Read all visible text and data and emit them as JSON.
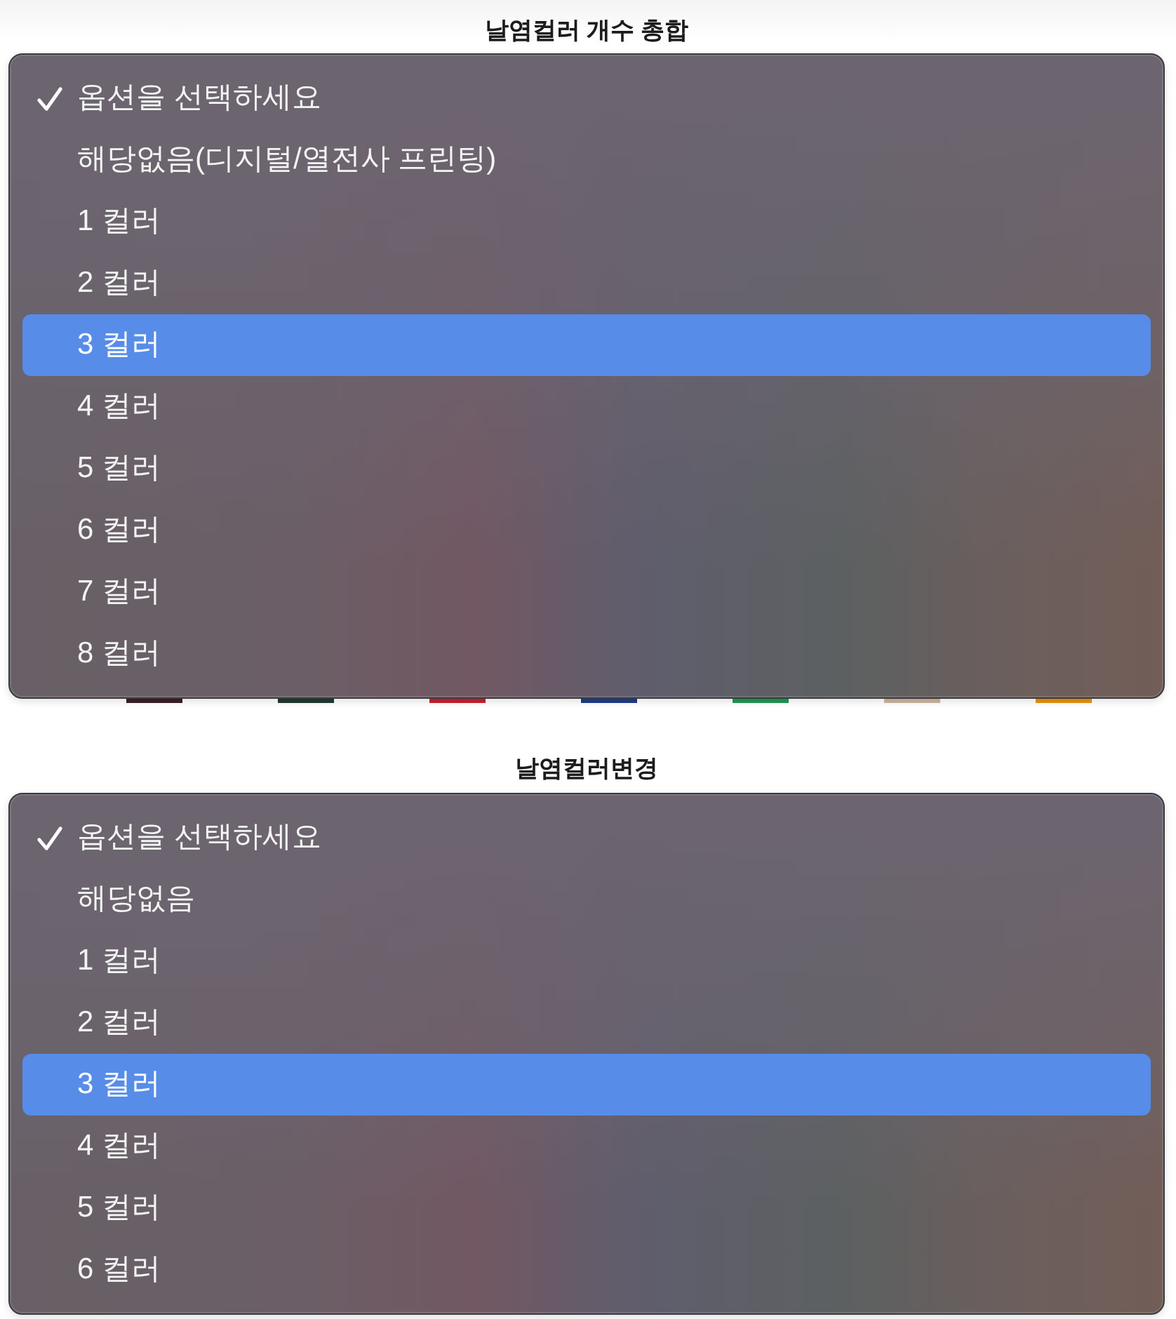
{
  "dropdowns": [
    {
      "label": "날염컬러 개수 총합",
      "options": [
        {
          "text": "옵션을 선택하세요",
          "checked": true,
          "selected": false
        },
        {
          "text": "해당없음(디지털/열전사 프린팅)",
          "checked": false,
          "selected": false
        },
        {
          "text": "1 컬러",
          "checked": false,
          "selected": false
        },
        {
          "text": "2 컬러",
          "checked": false,
          "selected": false
        },
        {
          "text": "3 컬러",
          "checked": false,
          "selected": true
        },
        {
          "text": "4 컬러",
          "checked": false,
          "selected": false
        },
        {
          "text": "5 컬러",
          "checked": false,
          "selected": false
        },
        {
          "text": "6 컬러",
          "checked": false,
          "selected": false
        },
        {
          "text": "7 컬러",
          "checked": false,
          "selected": false
        },
        {
          "text": "8 컬러",
          "checked": false,
          "selected": false
        }
      ]
    },
    {
      "label": "날염컬러변경",
      "options": [
        {
          "text": "옵션을 선택하세요",
          "checked": true,
          "selected": false
        },
        {
          "text": "해당없음",
          "checked": false,
          "selected": false
        },
        {
          "text": "1 컬러",
          "checked": false,
          "selected": false
        },
        {
          "text": "2 컬러",
          "checked": false,
          "selected": false
        },
        {
          "text": "3 컬러",
          "checked": false,
          "selected": true
        },
        {
          "text": "4 컬러",
          "checked": false,
          "selected": false
        },
        {
          "text": "5 컬러",
          "checked": false,
          "selected": false
        },
        {
          "text": "6 컬러",
          "checked": false,
          "selected": false
        }
      ]
    }
  ],
  "swatches": [
    {
      "color": "#3b1f2a"
    },
    {
      "color": "#1f3b31"
    },
    {
      "color": "#c9212b"
    },
    {
      "color": "#1f3d8c"
    },
    {
      "color": "#1f9a52"
    },
    {
      "color": "#cbb69c"
    },
    {
      "color": "#e8920c"
    }
  ]
}
